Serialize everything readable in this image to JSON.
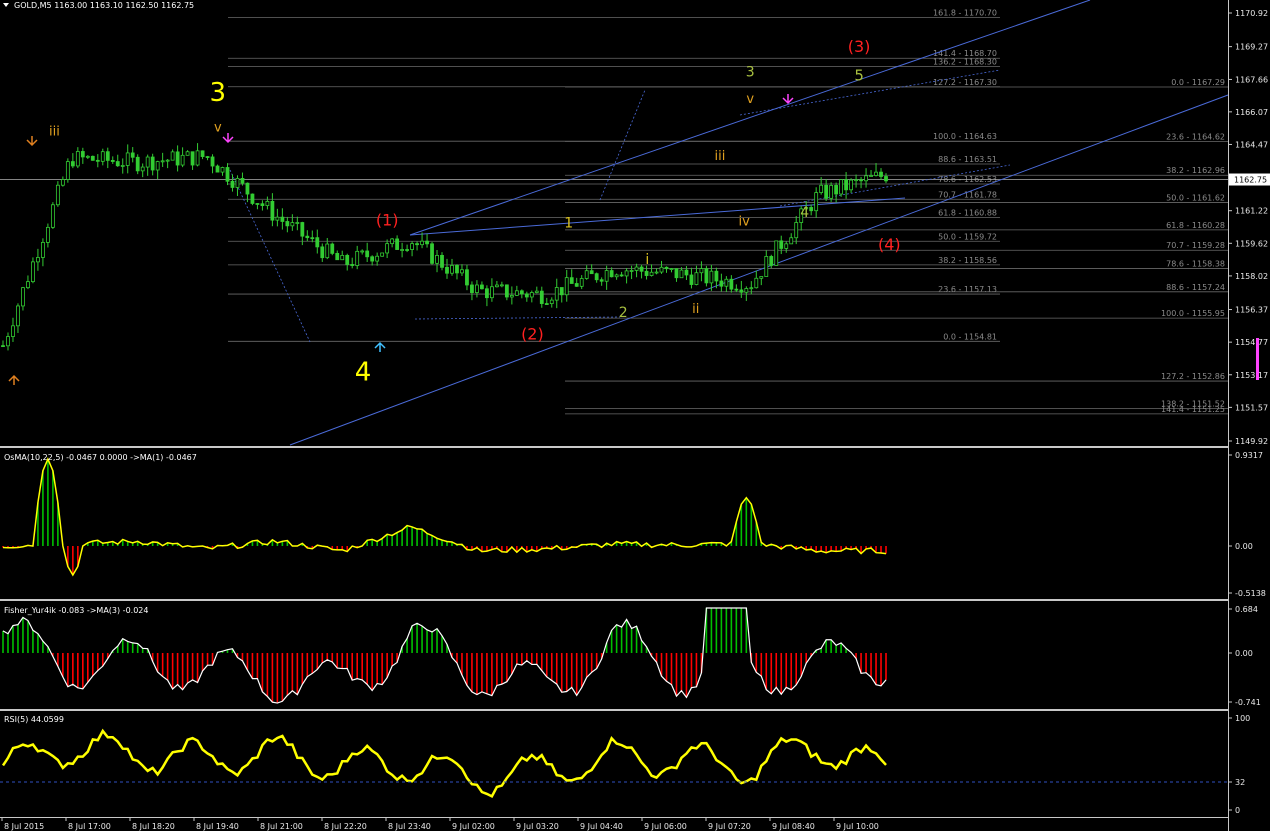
{
  "main": {
    "header": "GOLD,M5  1163.00 1163.10 1162.50 1162.75",
    "current_price": "1162.75",
    "price_ticks": [
      "1170.92",
      "1169.27",
      "1167.66",
      "1166.07",
      "1164.47",
      "1162.87",
      "1161.22",
      "1159.62",
      "1158.02",
      "1156.37",
      "1154.77",
      "1153.17",
      "1151.57",
      "1149.92"
    ],
    "fib_labels": [
      {
        "text": "161.8 - 1170.70",
        "price": 1170.7,
        "col": 2
      },
      {
        "text": "141.4 - 1168.70",
        "price": 1168.7,
        "col": 2
      },
      {
        "text": "136.2 - 1168.30",
        "price": 1168.3,
        "col": 2
      },
      {
        "text": "127.2 - 1167.30",
        "price": 1167.3,
        "col": 2
      },
      {
        "text": "100.0 - 1164.63",
        "price": 1164.63,
        "col": 2
      },
      {
        "text": "88.6 - 1163.51",
        "price": 1163.51,
        "col": 2
      },
      {
        "text": "78.6 - 1162.53",
        "price": 1162.53,
        "col": 2
      },
      {
        "text": "70.7 - 1161.78",
        "price": 1161.78,
        "col": 2
      },
      {
        "text": "61.8 - 1160.88",
        "price": 1160.88,
        "col": 2
      },
      {
        "text": "50.0 - 1159.72",
        "price": 1159.72,
        "col": 2
      },
      {
        "text": "38.2 - 1158.56",
        "price": 1158.56,
        "col": 2
      },
      {
        "text": "23.6 - 1157.13",
        "price": 1157.13,
        "col": 2
      },
      {
        "text": "0.0 - 1154.81",
        "price": 1154.81,
        "col": 2
      },
      {
        "text": "0.0 - 1167.29",
        "price": 1167.29,
        "col": 3
      },
      {
        "text": "23.6 - 1164.62",
        "price": 1164.62,
        "col": 3
      },
      {
        "text": "38.2 - 1162.96",
        "price": 1162.96,
        "col": 3
      },
      {
        "text": "50.0 - 1161.62",
        "price": 1161.62,
        "col": 3
      },
      {
        "text": "61.8 - 1160.28",
        "price": 1160.28,
        "col": 3
      },
      {
        "text": "70.7 - 1159.28",
        "price": 1159.28,
        "col": 3
      },
      {
        "text": "78.6 - 1158.38",
        "price": 1158.38,
        "col": 3
      },
      {
        "text": "88.6 - 1157.24",
        "price": 1157.24,
        "col": 3
      },
      {
        "text": "100.0 - 1155.95",
        "price": 1155.95,
        "col": 3
      },
      {
        "text": "127.2 - 1152.86",
        "price": 1152.86,
        "col": 3
      },
      {
        "text": "138.2 - 1151.52",
        "price": 1151.52,
        "col": 3
      },
      {
        "text": "141.4 - 1151.25",
        "price": 1151.25,
        "col": 3
      }
    ],
    "wave_labels": [
      {
        "text": "iii",
        "color": "#e0a020",
        "t": 0.045,
        "p": 1164.9,
        "size": 13
      },
      {
        "text": "3",
        "color": "#ffff00",
        "t": 0.18,
        "p": 1166.6,
        "size": 26
      },
      {
        "text": "v",
        "color": "#e0a020",
        "t": 0.18,
        "p": 1165.1,
        "size": 13
      },
      {
        "text": "4",
        "color": "#ffff00",
        "t": 0.3,
        "p": 1152.9,
        "size": 26
      },
      {
        "text": "(1)",
        "color": "#ff2020",
        "t": 0.32,
        "p": 1160.5,
        "size": 16
      },
      {
        "text": "(2)",
        "color": "#ff2020",
        "t": 0.44,
        "p": 1154.9,
        "size": 16
      },
      {
        "text": "1",
        "color": "#d8c020",
        "t": 0.47,
        "p": 1160.4,
        "size": 14
      },
      {
        "text": "2",
        "color": "#a8c040",
        "t": 0.515,
        "p": 1156.0,
        "size": 14
      },
      {
        "text": "i",
        "color": "#d8c020",
        "t": 0.535,
        "p": 1158.6,
        "size": 14
      },
      {
        "text": "ii",
        "color": "#e0a020",
        "t": 0.575,
        "p": 1156.2,
        "size": 13
      },
      {
        "text": "iii",
        "color": "#e0a020",
        "t": 0.595,
        "p": 1163.7,
        "size": 13
      },
      {
        "text": "iv",
        "color": "#e0a020",
        "t": 0.615,
        "p": 1160.5,
        "size": 13
      },
      {
        "text": "3",
        "color": "#a8c040",
        "t": 0.62,
        "p": 1167.8,
        "size": 14
      },
      {
        "text": "v",
        "color": "#e0a020",
        "t": 0.62,
        "p": 1166.5,
        "size": 13
      },
      {
        "text": "4",
        "color": "#a8c040",
        "t": 0.665,
        "p": 1160.9,
        "size": 14
      },
      {
        "text": "5",
        "color": "#a8c040",
        "t": 0.71,
        "p": 1167.6,
        "size": 15
      },
      {
        "text": "(3)",
        "color": "#ff2020",
        "t": 0.71,
        "p": 1169.0,
        "size": 16
      },
      {
        "text": "(4)",
        "color": "#ff2020",
        "t": 0.735,
        "p": 1159.3,
        "size": 16
      }
    ]
  },
  "osma": {
    "header": "OsMA(10,22,5) -0.0467 0.0000 ->MA(1) -0.0467",
    "ticks": [
      "0.9317",
      "0.00",
      "-0.5138"
    ]
  },
  "fisher": {
    "header": "Fisher_Yur4ik -0.083 ->MA(3) -0.024",
    "ticks": [
      "0.684",
      "0.00",
      "-0.741"
    ]
  },
  "rsi": {
    "header": "RSI(5) 44.0599",
    "ticks": [
      "100",
      "32",
      "0"
    ]
  },
  "time_labels": [
    "8 Jul 2015",
    "8 Jul 17:00",
    "8 Jul 18:20",
    "8 Jul 19:40",
    "8 Jul 21:00",
    "8 Jul 22:20",
    "8 Jul 23:40",
    "9 Jul 02:00",
    "9 Jul 03:20",
    "9 Jul 04:40",
    "9 Jul 06:00",
    "9 Jul 07:20",
    "9 Jul 08:40",
    "9 Jul 10:00"
  ],
  "colors": {
    "bull": "#00c000",
    "bear": "#ff0000",
    "candle": "#33cc33",
    "signal": "#ffff00",
    "rsi": "#ffff00",
    "trend": "#4a6ad8",
    "fib_line": "#6a6a6a",
    "bid": "#b0b0b0"
  },
  "chart_data": {
    "type": "line",
    "title": "GOLD,M5",
    "x": [
      "8 Jul 2015",
      "8 Jul 17:00",
      "8 Jul 18:20",
      "8 Jul 19:40",
      "8 Jul 21:00",
      "8 Jul 22:20",
      "8 Jul 23:40",
      "9 Jul 02:00",
      "9 Jul 03:20",
      "9 Jul 04:40",
      "9 Jul 06:00",
      "9 Jul 07:20",
      "9 Jul 08:40",
      "9 Jul 10:00"
    ],
    "ylim": [
      1149.92,
      1170.92
    ],
    "series": [
      {
        "name": "GOLD,M5",
        "values": [
          1154.6,
          1163.8,
          1163.6,
          1163.9,
          1161.0,
          1158.6,
          1159.8,
          1157.3,
          1157.1,
          1158.4,
          1158.1,
          1157.6,
          1162.0,
          1163.0
        ]
      },
      {
        "name": "OsMA(10,22,5)",
        "values": [
          0.0,
          0.02,
          0.05,
          -0.03,
          0.05,
          -0.05,
          0.2,
          -0.05,
          -0.03,
          0.02,
          0.01,
          0.03,
          -0.05,
          -0.05
        ]
      },
      {
        "name": "Fisher_Yur4ik",
        "values": [
          0.3,
          -0.2,
          -0.1,
          -0.3,
          -0.4,
          -0.5,
          0.2,
          -0.3,
          -0.6,
          0.2,
          -0.3,
          -0.3,
          -0.2,
          -0.1
        ]
      },
      {
        "name": "RSI(5)",
        "values": [
          48,
          70,
          60,
          55,
          62,
          48,
          52,
          34,
          42,
          58,
          55,
          46,
          70,
          44
        ]
      }
    ]
  }
}
